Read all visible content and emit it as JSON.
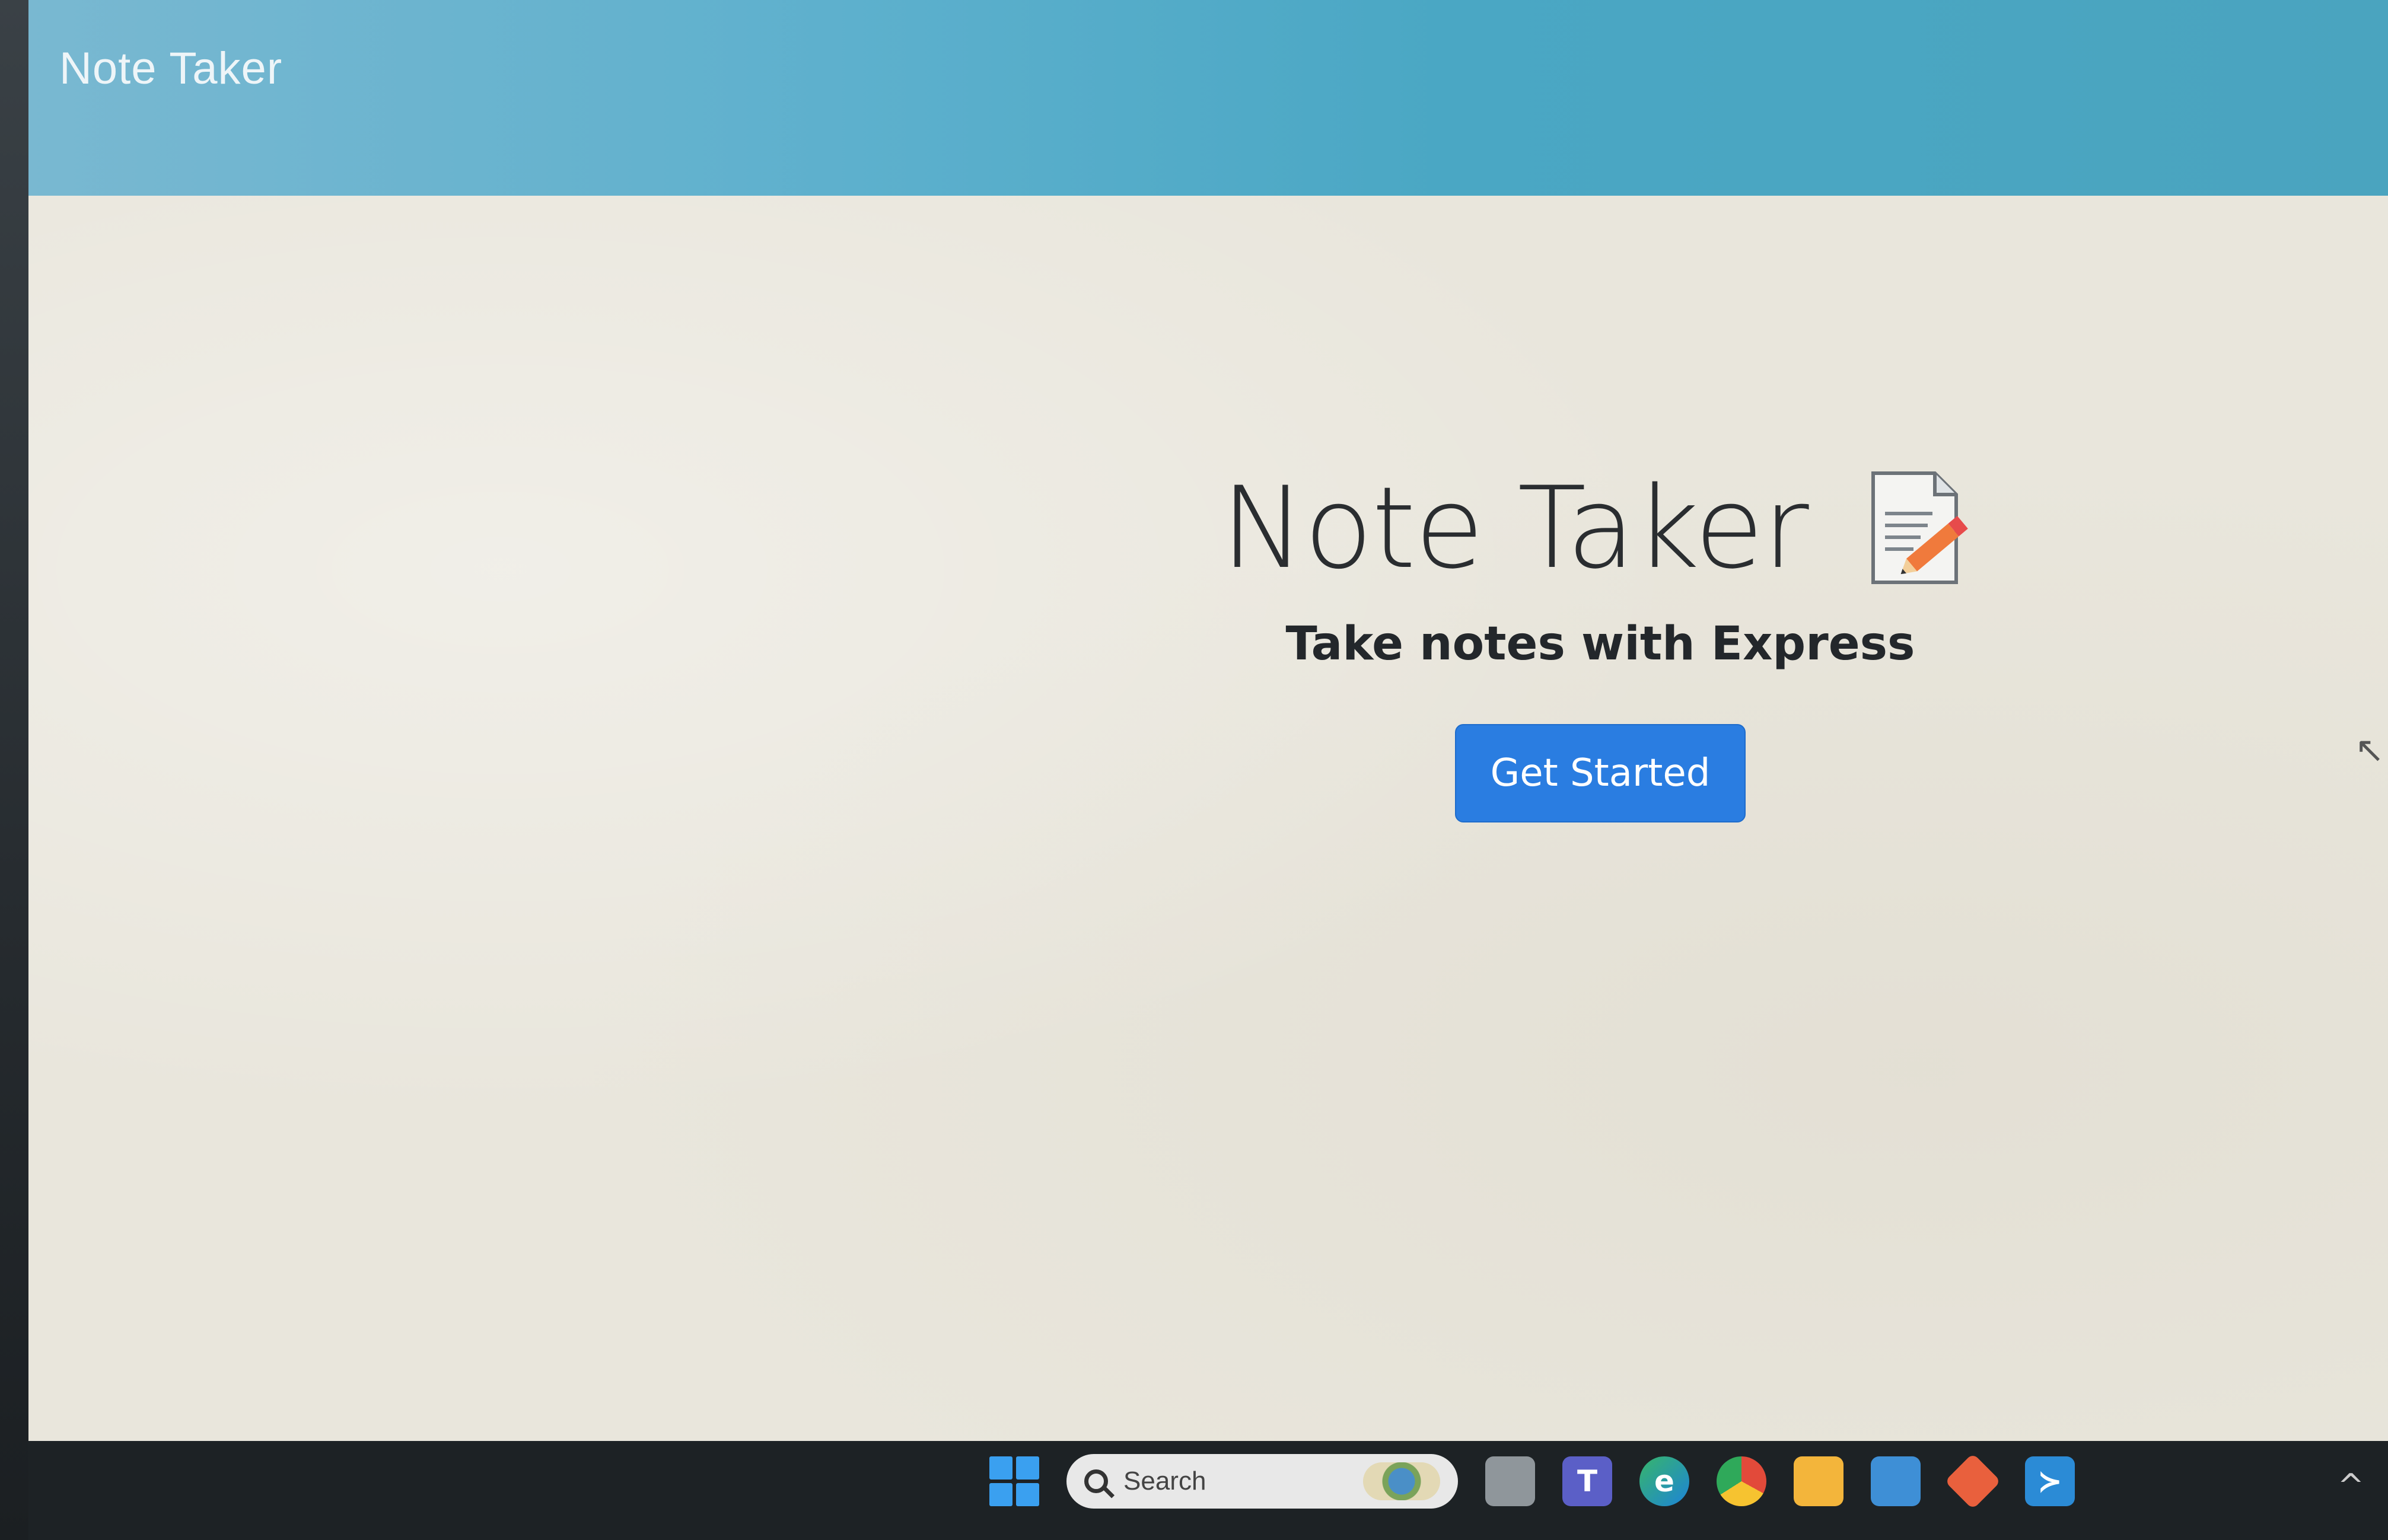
{
  "navbar": {
    "brand": "Note Taker"
  },
  "hero": {
    "title": "Note Taker",
    "subtitle": "Take notes with Express",
    "button_label": "Get Started",
    "icon": "memo-icon"
  },
  "taskbar": {
    "search_label": "Search",
    "icons": [
      "windows-start-icon",
      "search-icon",
      "task-view-icon",
      "teams-icon",
      "edge-icon",
      "chrome-icon",
      "file-explorer-icon",
      "photos-icon",
      "git-icon",
      "vscode-icon"
    ],
    "tray_chevron": "^"
  },
  "colors": {
    "navbar": "#4aa7c4",
    "button": "#2a7de1",
    "background": "#e9e6dc"
  }
}
